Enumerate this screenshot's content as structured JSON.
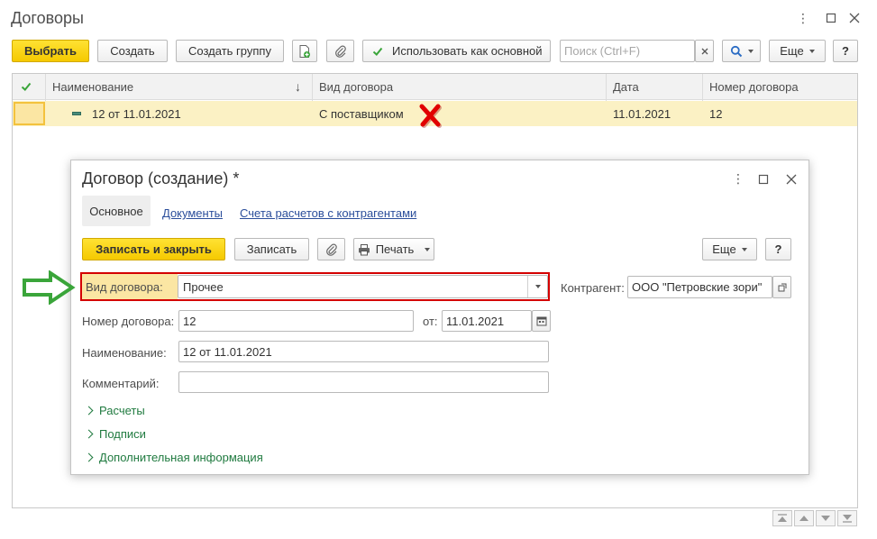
{
  "window": {
    "title": "Договоры"
  },
  "toolbar": {
    "select_label": "Выбрать",
    "create_label": "Создать",
    "create_group_label": "Создать группу",
    "use_main_label": "Использовать как основной",
    "search_placeholder": "Поиск (Ctrl+F)",
    "more_label": "Еще",
    "help_label": "?"
  },
  "table": {
    "columns": [
      "Наименование",
      "Вид договора",
      "Дата",
      "Номер договора"
    ],
    "rows": [
      {
        "name": "12 от 11.01.2021",
        "type": "С поставщиком",
        "date": "11.01.2021",
        "number": "12"
      }
    ]
  },
  "dialog": {
    "title": "Договор (создание) *",
    "tabs": [
      "Основное",
      "Документы",
      "Счета расчетов с контрагентами"
    ],
    "save_close_label": "Записать и закрыть",
    "save_label": "Записать",
    "print_label": "Печать",
    "more_label": "Еще",
    "help_label": "?",
    "fields": {
      "contract_type_label": "Вид договора:",
      "contract_type_value": "Прочее",
      "counterparty_label": "Контрагент:",
      "counterparty_value": "ООО \"Петровские зори\"",
      "number_label": "Номер договора:",
      "number_value": "12",
      "from_label": "от:",
      "date_value": "11.01.2021",
      "name_label": "Наименование:",
      "name_value": "12 от 11.01.2021",
      "comment_label": "Комментарий:",
      "comment_value": ""
    },
    "groups": [
      "Расчеты",
      "Подписи",
      "Дополнительная информация"
    ]
  },
  "colors": {
    "accent_yellow": "#f5c900",
    "row_highlight": "#fbf1c4",
    "highlight_red": "#d40000",
    "arrow_green": "#3aa53a",
    "link_blue": "#2b4e9b",
    "group_green": "#1f7a3f"
  }
}
